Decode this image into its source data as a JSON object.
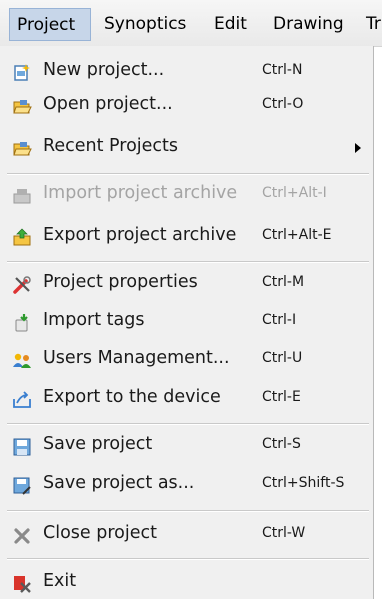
{
  "menubar": {
    "items": [
      {
        "label": "Project"
      },
      {
        "label": "Synoptics"
      },
      {
        "label": "Edit"
      },
      {
        "label": "Drawing"
      },
      {
        "label": "Tr"
      }
    ]
  },
  "menu": {
    "new_project": {
      "label": "New project...",
      "shortcut": "Ctrl-N",
      "icon": "new-project-icon"
    },
    "open_project": {
      "label": "Open project...",
      "shortcut": "Ctrl-O",
      "icon": "open-folder-icon"
    },
    "recent_projects": {
      "label": "Recent Projects",
      "shortcut": "",
      "icon": "recent-folder-icon"
    },
    "import_archive": {
      "label": "Import project archive",
      "shortcut": "Ctrl+Alt-I",
      "icon": "import-archive-icon",
      "disabled": true
    },
    "export_archive": {
      "label": "Export project archive",
      "shortcut": "Ctrl+Alt-E",
      "icon": "export-archive-icon"
    },
    "properties": {
      "label": "Project properties",
      "shortcut": "Ctrl-M",
      "icon": "tools-icon"
    },
    "import_tags": {
      "label": "Import tags",
      "shortcut": "Ctrl-I",
      "icon": "import-tags-icon"
    },
    "users": {
      "label": "Users Management...",
      "shortcut": "Ctrl-U",
      "icon": "users-icon"
    },
    "export_device": {
      "label": "Export to the device",
      "shortcut": "Ctrl-E",
      "icon": "export-device-icon"
    },
    "save": {
      "label": "Save project",
      "shortcut": "Ctrl-S",
      "icon": "save-icon"
    },
    "save_as": {
      "label": "Save project as...",
      "shortcut": "Ctrl+Shift-S",
      "icon": "save-as-icon"
    },
    "close": {
      "label": "Close project",
      "shortcut": "Ctrl-W",
      "icon": "close-icon"
    },
    "exit": {
      "label": "Exit",
      "shortcut": "",
      "icon": "exit-icon"
    }
  }
}
